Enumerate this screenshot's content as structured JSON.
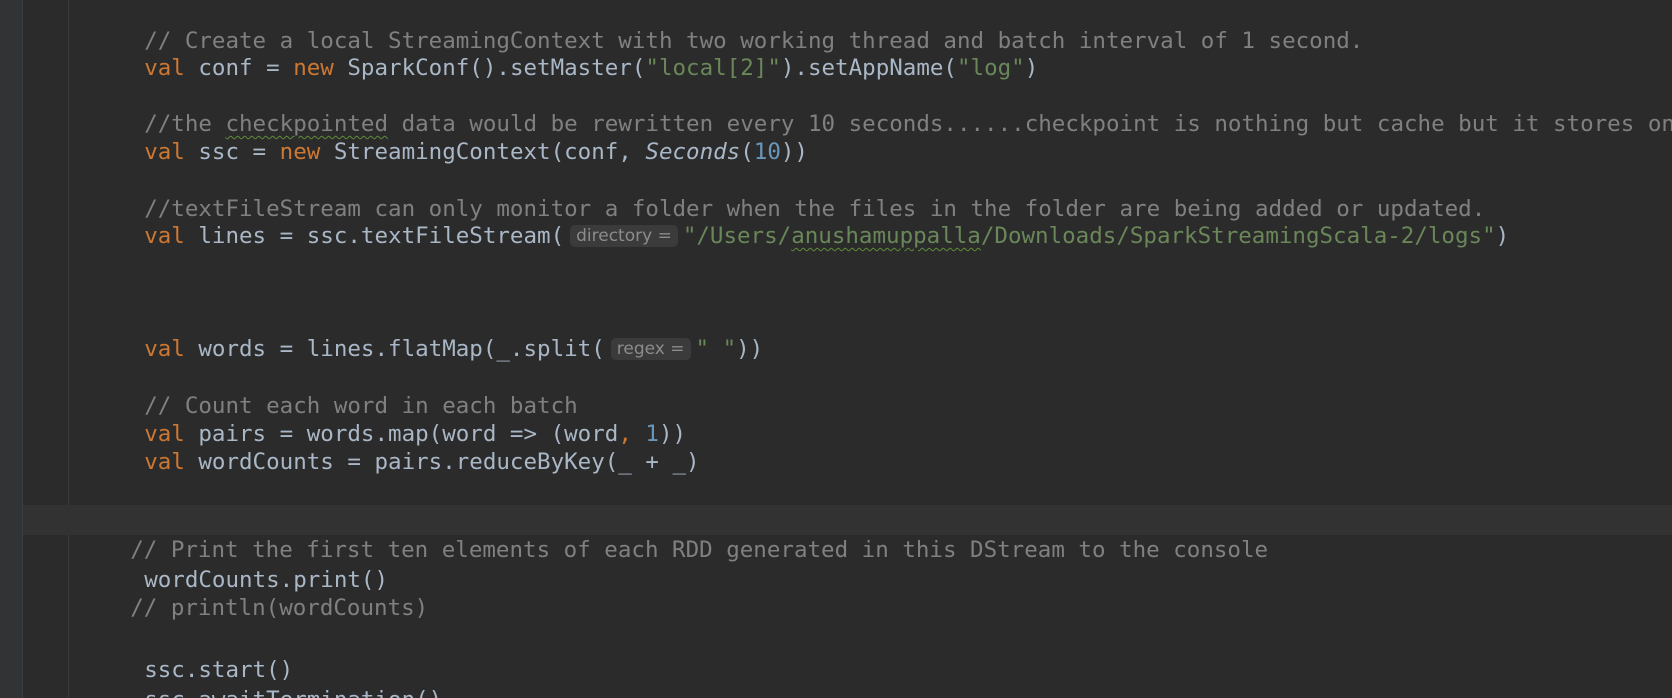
{
  "hints": {
    "directory": "directory =",
    "regex": "regex ="
  },
  "lines": {
    "l1": {
      "text": "// Create a local StreamingContext with two working thread and batch interval of 1 second."
    },
    "l2": {
      "kw1": "val",
      "t1": " conf = ",
      "kw2": "new",
      "t2": " SparkConf().setMaster(",
      "s1": "\"local[2]\"",
      "t3": ").setAppName(",
      "s2": "\"log\"",
      "t4": ")"
    },
    "l3": {
      "c1": "//the ",
      "typo": "checkpointed",
      "c2": " data would be rewritten every 10 seconds......checkpoint is nothing but cache but it stores on"
    },
    "l4": {
      "kw1": "val",
      "t1": " ssc = ",
      "kw2": "new",
      "t2": " StreamingContext(conf, ",
      "it": "Seconds",
      "t3": "(",
      "n1": "10",
      "t4": "))"
    },
    "l5": {
      "text": "//textFileStream can only monitor a folder when the files in the folder are being added or updated."
    },
    "l6": {
      "kw1": "val",
      "t1": " lines = ssc.textFileStream(",
      "s1": "\"/Users/",
      "typo": "anushamuppalla",
      "s2": "/Downloads/SparkStreamingScala-2/logs\"",
      "t2": ")"
    },
    "l7": {
      "kw1": "val",
      "t1": " words = lines.flatMap(_.split(",
      "s1": "\" \"",
      "t2": "))"
    },
    "l8": {
      "text": "// Count each word in each batch"
    },
    "l9": {
      "kw1": "val",
      "t1": " pairs = words.map(word => (word",
      "comma": ",",
      "t2": " ",
      "n1": "1",
      "t3": "))"
    },
    "l10": {
      "kw1": "val",
      "t1": " wordCounts = pairs.reduceByKey(_ + _)"
    },
    "l11": {
      "text": "// Print the first ten elements of each RDD generated in this DStream to the console"
    },
    "l12": {
      "text": "wordCounts.print()"
    },
    "l13": {
      "text": "// println(wordCounts)"
    },
    "l14": {
      "text": "ssc.start()"
    },
    "l15": {
      "text": "ssc.awaitTermination()"
    }
  }
}
